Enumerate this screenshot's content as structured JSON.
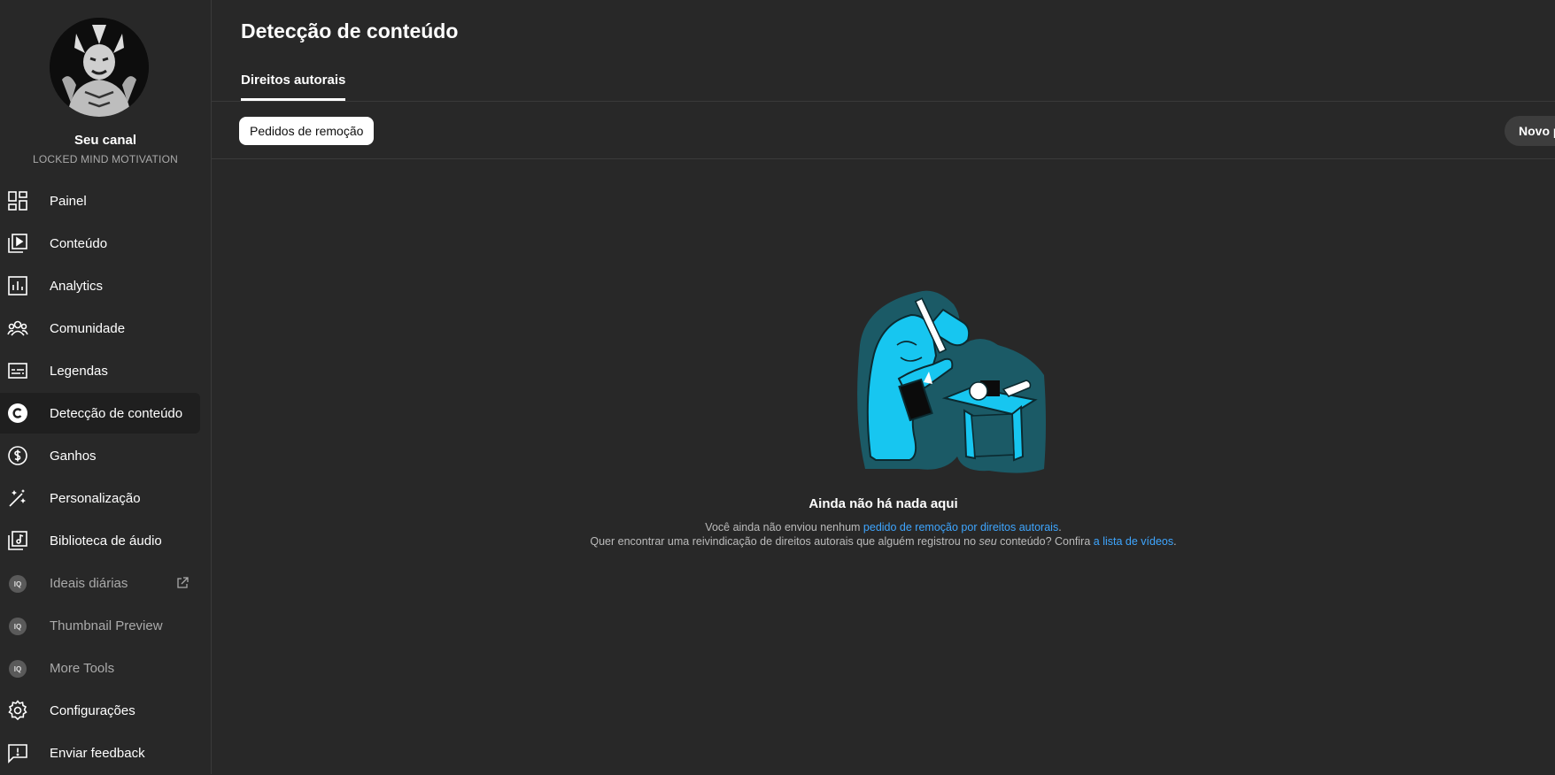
{
  "channel": {
    "label": "Seu canal",
    "name": "LOCKED MIND MOTIVATION"
  },
  "sidebar": {
    "items": [
      {
        "label": "Painel",
        "icon": "dashboard-icon"
      },
      {
        "label": "Conteúdo",
        "icon": "content-icon"
      },
      {
        "label": "Analytics",
        "icon": "analytics-icon"
      },
      {
        "label": "Comunidade",
        "icon": "community-icon"
      },
      {
        "label": "Legendas",
        "icon": "subtitles-icon"
      },
      {
        "label": "Detecção de conteúdo",
        "icon": "copyright-icon",
        "active": true
      },
      {
        "label": "Ganhos",
        "icon": "earn-icon"
      },
      {
        "label": "Personalização",
        "icon": "customization-icon"
      },
      {
        "label": "Biblioteca de áudio",
        "icon": "audio-library-icon"
      },
      {
        "label": "Ideais diárias",
        "icon": "vidiq-icon",
        "external": true
      },
      {
        "label": "Thumbnail Preview",
        "icon": "vidiq-icon"
      },
      {
        "label": "More Tools",
        "icon": "vidiq-icon"
      },
      {
        "label": "Configurações",
        "icon": "settings-icon"
      },
      {
        "label": "Enviar feedback",
        "icon": "feedback-icon"
      }
    ],
    "ext_badge": "IQ"
  },
  "main": {
    "title": "Detecção de conteúdo",
    "tab": "Direitos autorais",
    "filter_chip": "Pedidos de remoção",
    "new_button": "Novo p"
  },
  "empty_state": {
    "title": "Ainda não há nada aqui",
    "line1_prefix": "Você ainda não enviou nenhum ",
    "line1_link": "pedido de remoção por direitos autorais",
    "line1_suffix": ".",
    "line2_prefix": "Quer encontrar uma reivindicação de direitos autorais que alguém registrou no ",
    "line2_em": "seu",
    "line2_middle": " conteúdo? Confira ",
    "line2_link": "a lista de vídeos",
    "line2_suffix": "."
  },
  "colors": {
    "background": "#282828",
    "link": "#3ea6ff",
    "illustration_primary": "#17c6f0",
    "illustration_dark": "#1b5a66"
  }
}
